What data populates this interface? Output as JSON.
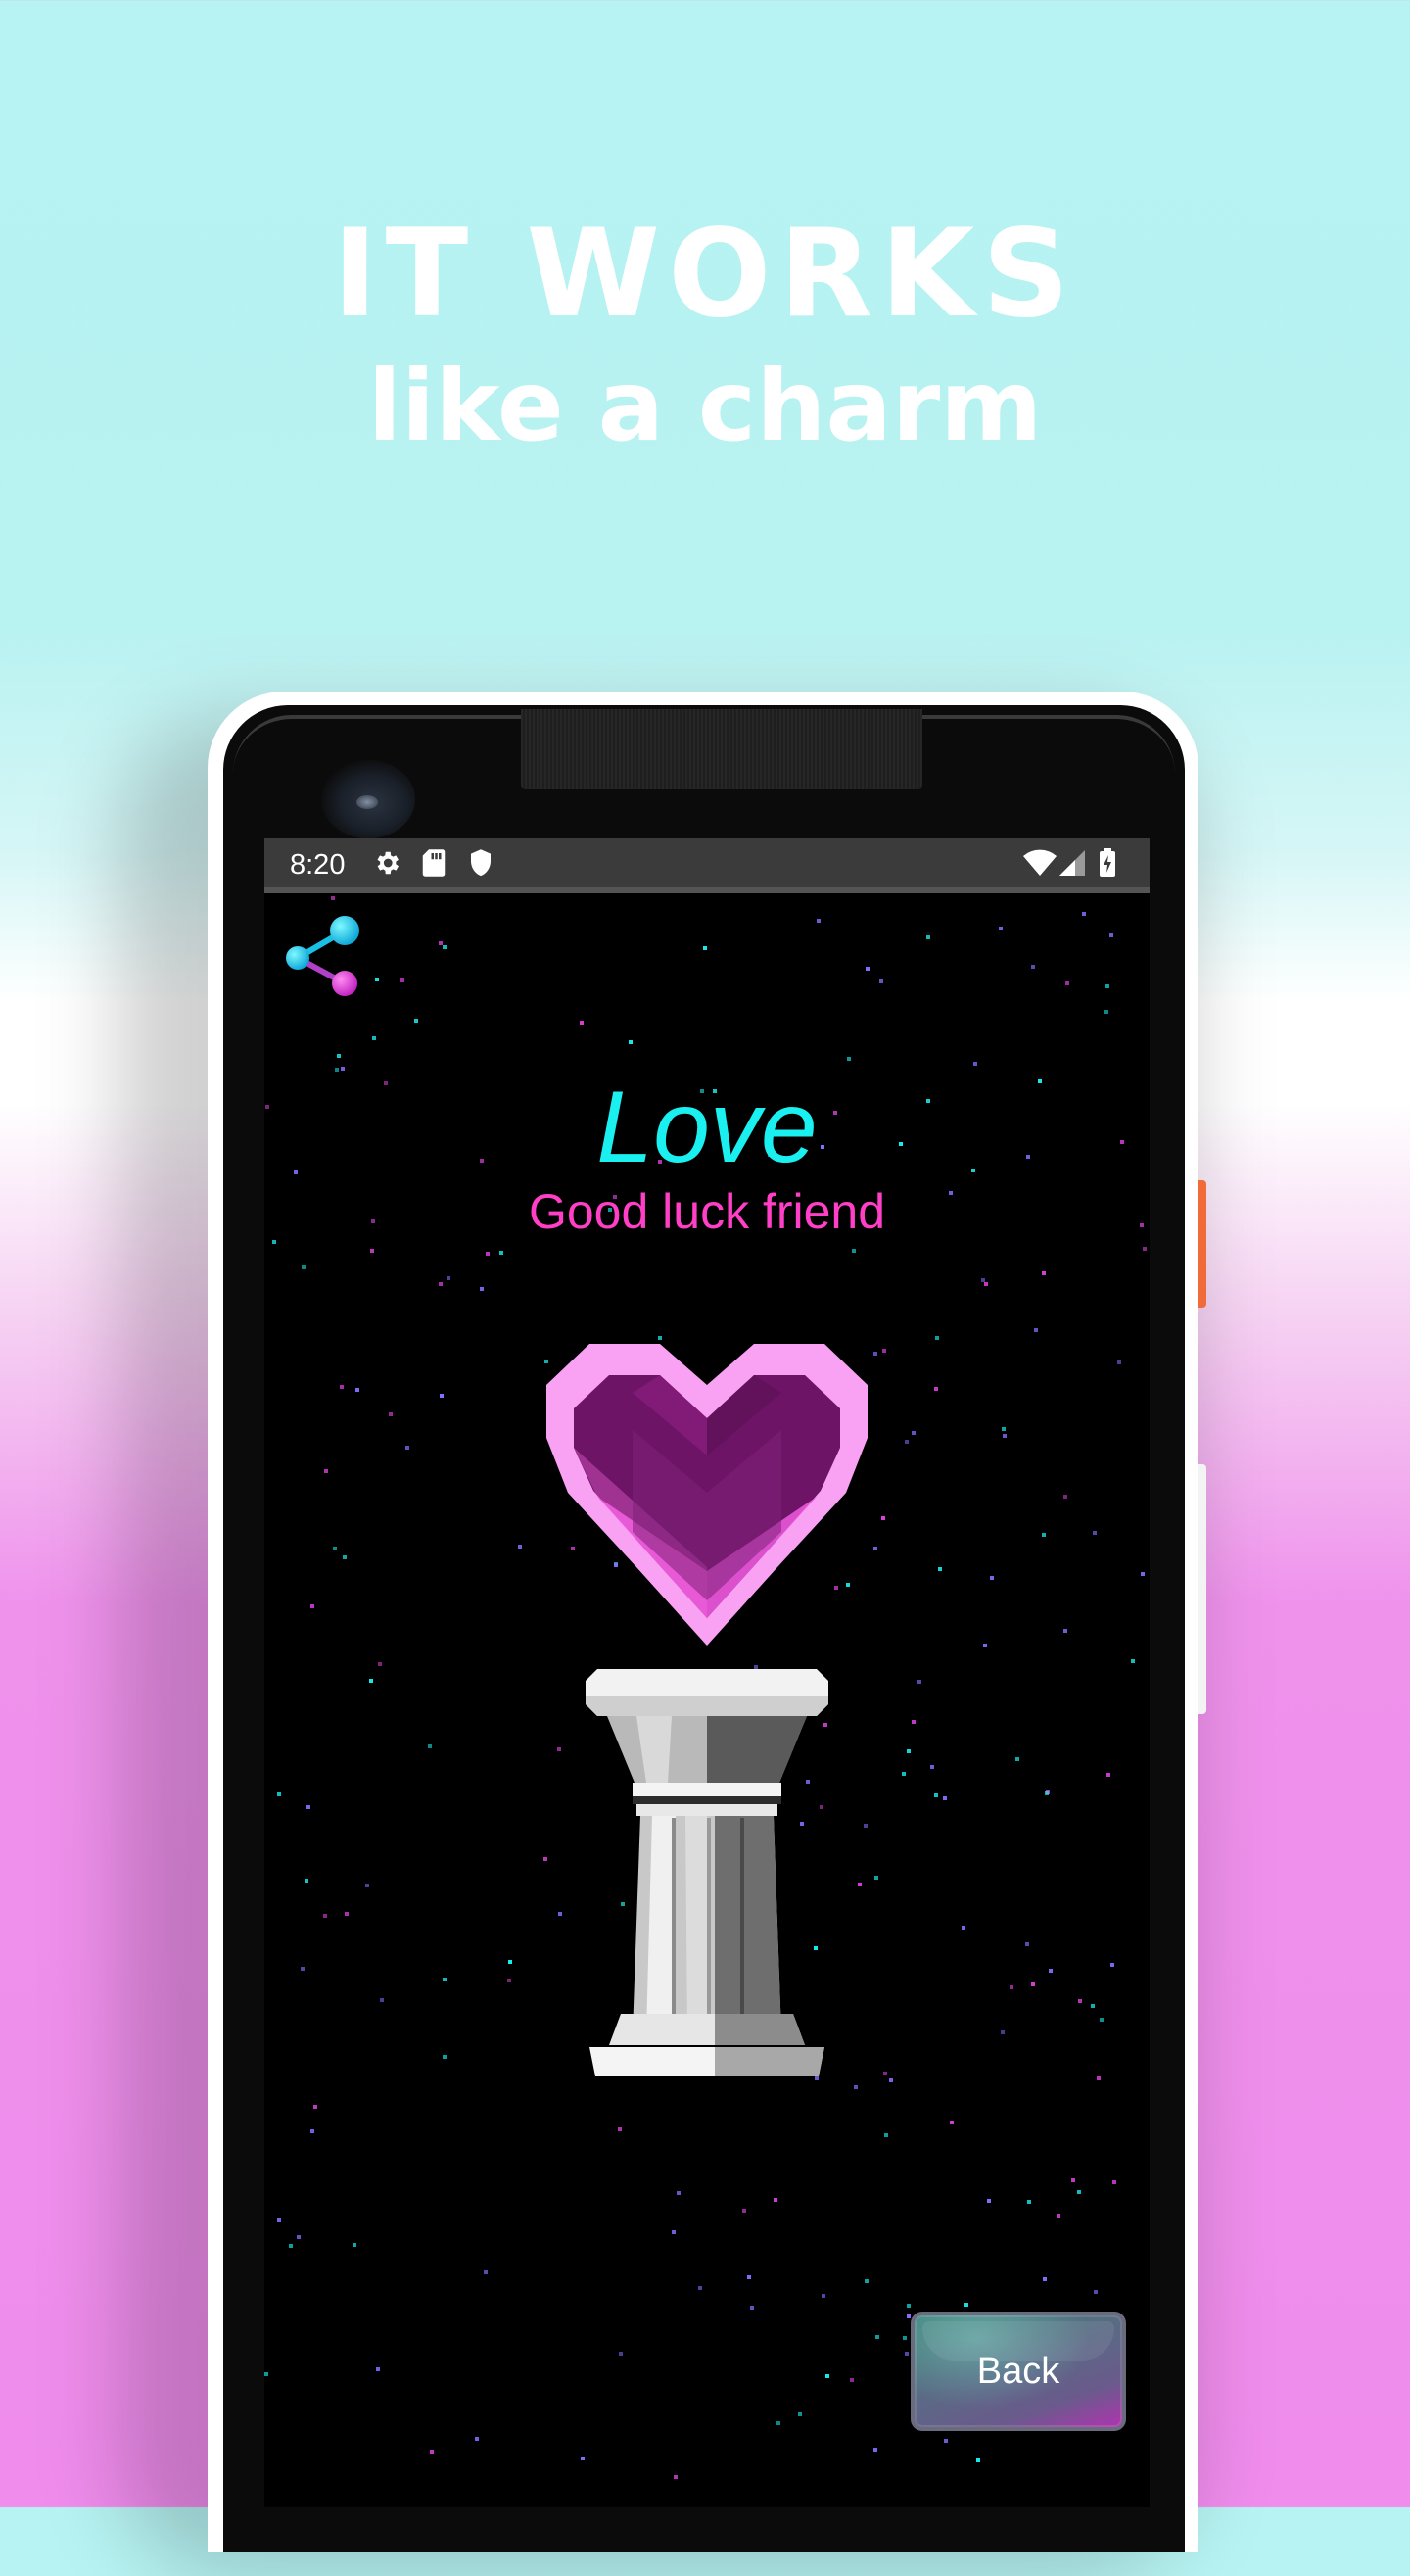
{
  "headline": {
    "line1": "IT WORKS",
    "line2": "like a charm"
  },
  "status_bar": {
    "time": "8:20",
    "left_icons": [
      "gear-icon",
      "sd-card-icon",
      "shield-icon"
    ],
    "right_icons": [
      "wifi-icon",
      "signal-icon",
      "battery-charging-icon"
    ]
  },
  "app": {
    "title": "Love",
    "subtitle": "Good luck friend",
    "back_label": "Back",
    "share_icon": "share-icon",
    "charm_icon": "heart-icon",
    "pedestal_icon": "pillar-icon"
  },
  "colors": {
    "background_top": "#b6f3f2",
    "background_bottom": "#ef8cec",
    "title": "#19f0ef",
    "subtitle": "#ff3fc6",
    "star_cyan": "#19f0ef",
    "star_magenta": "#e040e0",
    "heart_fill": "#6e1466",
    "heart_rim": "#f9a2f3"
  }
}
